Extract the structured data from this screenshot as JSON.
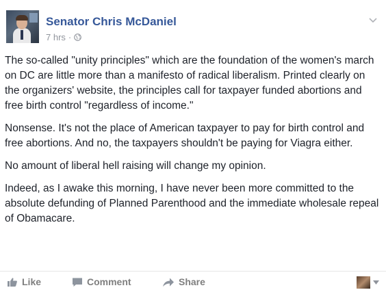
{
  "post": {
    "author": "Senator Chris McDaniel",
    "timestamp": "7 hrs",
    "separator": "·",
    "paragraphs": [
      "The so-called \"unity principles\" which are the foundation of the women's march on DC are little more than a manifesto of radical liberalism. Printed clearly on the organizers' website, the principles call for taxpayer funded abortions and free birth control \"regardless of income.\"",
      "Nonsense. It's not the place of American taxpayer to pay for birth control and free abortions. And no, the taxpayers shouldn't be paying for Viagra either.",
      "No amount of liberal hell raising will change my opinion.",
      "Indeed, as I awake this morning, I have never been more committed to the absolute defunding of Planned Parenthood and the immediate wholesale repeal of Obamacare."
    ]
  },
  "actions": {
    "like_label": "Like",
    "comment_label": "Comment",
    "share_label": "Share"
  },
  "icons": {
    "privacy": "globe-icon",
    "options": "chevron-down-icon",
    "like": "thumbs-up-icon",
    "comment": "speech-bubble-icon",
    "share": "share-arrow-icon"
  },
  "colors": {
    "author_link": "#365899",
    "meta_text": "#90949c",
    "body_text": "#1d2129",
    "action_text": "#7f7f7f"
  }
}
